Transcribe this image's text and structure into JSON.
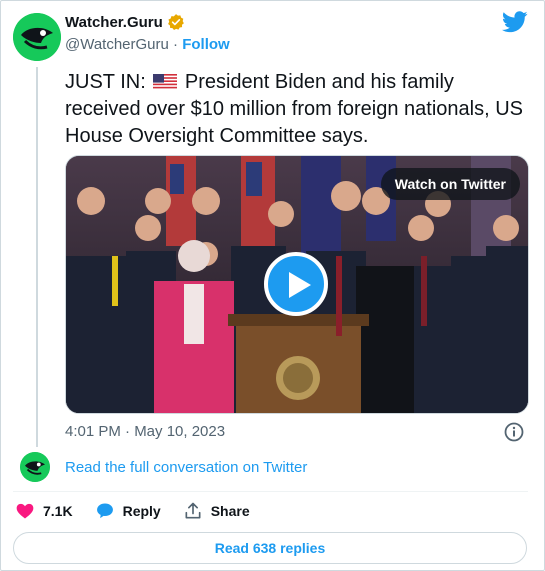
{
  "account": {
    "display_name": "Watcher.Guru",
    "handle": "@WatcherGuru",
    "separator": " · ",
    "follow_label": "Follow"
  },
  "tweet": {
    "text_prefix": "JUST IN: ",
    "text_body": " President Biden and his family received over $10 million from foreign nationals, US House Oversight Committee says.",
    "timestamp": "4:01 PM · May 10, 2023"
  },
  "media": {
    "watch_label": "Watch on Twitter"
  },
  "conversation": {
    "read_full_label": "Read the full conversation on Twitter"
  },
  "actions": {
    "like_count": "7.1K",
    "reply_label": "Reply",
    "share_label": "Share"
  },
  "replies": {
    "label": "Read 638 replies"
  },
  "colors": {
    "accent": "#1d9bf0",
    "like": "#f91880",
    "avatar_bg": "#16c95a",
    "text_secondary": "#536471"
  },
  "icons": {
    "logo": "twitter-bird-icon",
    "verified": "verified-badge-icon",
    "info": "info-icon",
    "like": "heart-icon",
    "reply": "speech-bubble-icon",
    "share": "share-upload-icon",
    "play": "play-icon"
  }
}
